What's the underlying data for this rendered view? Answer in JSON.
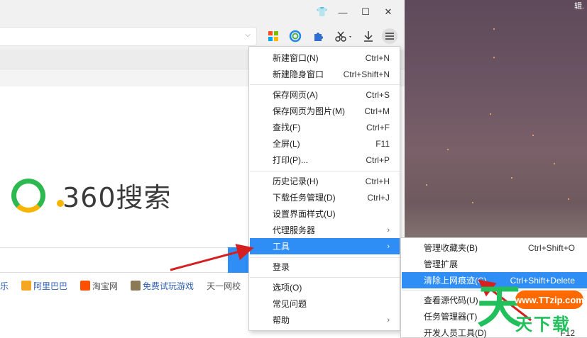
{
  "window": {
    "skin_glyph": "👕",
    "minimize_glyph": "—",
    "maximize_glyph": "☐",
    "close_glyph": "✕"
  },
  "address_bar": {
    "chevron": "⌵"
  },
  "toolbar_icons": [
    "windows-grid-icon",
    "360-ring-icon",
    "puzzle-icon",
    "scissors-icon",
    "download-icon",
    "menu-icon"
  ],
  "logo": {
    "text": "360搜索"
  },
  "quick_links": [
    {
      "label": "乐"
    },
    {
      "label": "阿里巴巴"
    },
    {
      "label": "淘宝网"
    },
    {
      "label": "免费试玩游戏"
    },
    {
      "label": "天一网校"
    }
  ],
  "wallpaper": {
    "corner_text": "辑."
  },
  "main_menu": {
    "items": [
      {
        "label": "新建窗口(N)",
        "shortcut": "Ctrl+N"
      },
      {
        "label": "新建隐身窗口",
        "shortcut": "Ctrl+Shift+N"
      },
      {
        "label": "保存网页(A)",
        "shortcut": "Ctrl+S"
      },
      {
        "label": "保存网页为图片(M)",
        "shortcut": "Ctrl+M"
      },
      {
        "label": "查找(F)",
        "shortcut": "Ctrl+F"
      },
      {
        "label": "全屏(L)",
        "shortcut": "F11"
      },
      {
        "label": "打印(P)...",
        "shortcut": "Ctrl+P"
      },
      {
        "label": "历史记录(H)",
        "shortcut": "Ctrl+H"
      },
      {
        "label": "下载任务管理(D)",
        "shortcut": "Ctrl+J"
      },
      {
        "label": "设置界面样式(U)",
        "shortcut": ""
      },
      {
        "label": "代理服务器",
        "shortcut": "›"
      },
      {
        "label": "工具",
        "shortcut": "›"
      },
      {
        "label": "登录",
        "shortcut": ""
      },
      {
        "label": "选项(O)",
        "shortcut": ""
      },
      {
        "label": "常见问题",
        "shortcut": ""
      },
      {
        "label": "帮助",
        "shortcut": "›"
      }
    ]
  },
  "tools_submenu": {
    "items": [
      {
        "label": "管理收藏夹(B)",
        "shortcut": "Ctrl+Shift+O"
      },
      {
        "label": "管理扩展",
        "shortcut": ""
      },
      {
        "label": "清除上网痕迹(C)...",
        "shortcut": "Ctrl+Shift+Delete"
      },
      {
        "label": "查看源代码(U)",
        "shortcut": ""
      },
      {
        "label": "任务管理器(T)",
        "shortcut": ""
      },
      {
        "label": "开发人员工具(D)",
        "shortcut": "F12"
      }
    ]
  },
  "watermark": {
    "bubble": "www.TTzip.com",
    "big_char": "天",
    "text": "天下载"
  },
  "colors": {
    "accent": "#2f8df6",
    "annotation_arrow": "#d42020",
    "logo_green": "#2eb950",
    "logo_yellow": "#f7b500"
  }
}
